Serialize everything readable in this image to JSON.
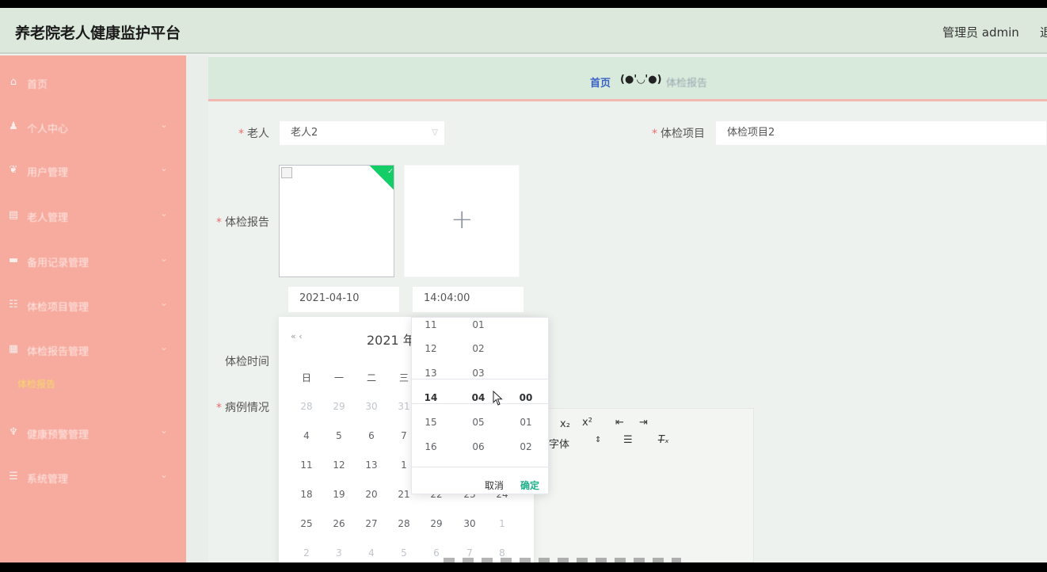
{
  "header": {
    "title": "养老院老人健康监护平台",
    "user": "管理员 admin",
    "logout": "退"
  },
  "sidebar": {
    "items": [
      {
        "icon": "home-icon",
        "glyph": "⌂",
        "label": "首页"
      },
      {
        "icon": "user-icon",
        "glyph": "♟",
        "label": "个人中心"
      },
      {
        "icon": "users-icon",
        "glyph": "❦",
        "label": "用户管理"
      },
      {
        "icon": "elder-icon",
        "glyph": "▤",
        "label": "老人管理"
      },
      {
        "icon": "chat-icon",
        "glyph": "▬",
        "label": "备用记录管理"
      },
      {
        "icon": "list-icon",
        "glyph": "☷",
        "label": "体检项目管理"
      },
      {
        "icon": "grid-icon",
        "glyph": "▦",
        "label": "体检报告管理"
      },
      {
        "icon": "bell-icon",
        "glyph": "♆",
        "label": "健康预警管理"
      },
      {
        "icon": "menu-icon",
        "glyph": "☰",
        "label": "系统管理"
      }
    ],
    "sub_label": "体检报告"
  },
  "breadcrumb": {
    "home": "首页",
    "face": "(●'◡'●)",
    "current": "体检报告"
  },
  "form": {
    "elder_label": "老人",
    "elder_value": "老人2",
    "item_label": "体检项目",
    "item_value": "体检项目2",
    "report_label": "体检报告",
    "time_label": "体检时间",
    "date_value": "2021-04-10",
    "time_value": "14:04:00",
    "case_label": "病例情况"
  },
  "editor": {
    "font_select": "字体"
  },
  "date_picker": {
    "prev": "« ‹",
    "title": "2021 年",
    "weekdays": [
      "日",
      "一",
      "二",
      "三"
    ],
    "rows": [
      [
        "28",
        "29",
        "30",
        "31"
      ],
      [
        "4",
        "5",
        "6",
        "7"
      ],
      [
        "11",
        "12",
        "13",
        "1"
      ],
      [
        "18",
        "19",
        "20",
        "21",
        "22",
        "23",
        "24"
      ],
      [
        "25",
        "26",
        "27",
        "28",
        "29",
        "30",
        "1"
      ],
      [
        "2",
        "3",
        "4",
        "5",
        "6",
        "7",
        "8"
      ]
    ]
  },
  "time_picker": {
    "hours": [
      "11",
      "12",
      "13",
      "14",
      "15",
      "16"
    ],
    "minutes": [
      "01",
      "02",
      "03",
      "04",
      "05",
      "06"
    ],
    "seconds": [
      "00",
      "01",
      "02"
    ],
    "cancel": "取消",
    "confirm": "确定"
  }
}
